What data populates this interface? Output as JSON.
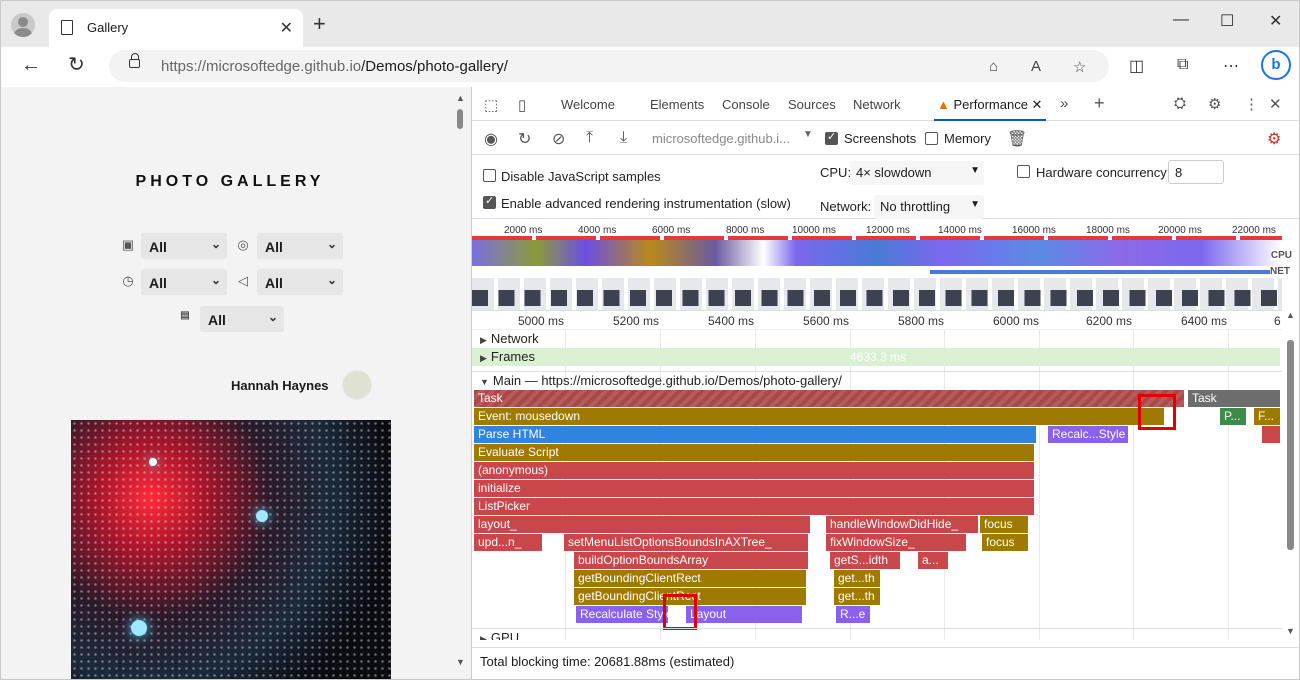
{
  "browser": {
    "tab_title": "Gallery",
    "url_host": "https://microsoftedge.github.io",
    "url_path": "/Demos/photo-gallery/"
  },
  "page": {
    "title": "PHOTO GALLERY",
    "filters": [
      {
        "icon": "camera-icon",
        "value": "All"
      },
      {
        "icon": "aperture-icon",
        "value": "All"
      },
      {
        "icon": "shutter-speed-icon",
        "value": "All"
      },
      {
        "icon": "speaker-icon",
        "value": "All"
      },
      {
        "icon": "iso-icon",
        "value": "All"
      }
    ],
    "user_name": "Hannah Haynes"
  },
  "devtools": {
    "tabs": [
      "Welcome",
      "Elements",
      "Console",
      "Sources",
      "Network",
      "Performance"
    ],
    "toolbar": {
      "recording_name": "microsoftedge.github.i...",
      "screenshots_label": "Screenshots",
      "memory_label": "Memory"
    },
    "settings": {
      "disable_js_label": "Disable JavaScript samples",
      "advanced_label": "Enable advanced rendering instrumentation (slow)",
      "cpu_label": "CPU:",
      "cpu_value": "4× slowdown",
      "network_label": "Network:",
      "network_value": "No throttling",
      "hw_label": "Hardware concurrency",
      "hw_value": "8"
    },
    "overview_ticks": [
      "2000 ms",
      "4000 ms",
      "6000 ms",
      "8000 ms",
      "10000 ms",
      "12000 ms",
      "14000 ms",
      "16000 ms",
      "18000 ms",
      "20000 ms",
      "22000 ms"
    ],
    "overview_labels": {
      "cpu": "CPU",
      "net": "NET"
    },
    "timeline_ticks": [
      "5000 ms",
      "5200 ms",
      "5400 ms",
      "5600 ms",
      "5800 ms",
      "6000 ms",
      "6200 ms",
      "6400 ms",
      "6"
    ],
    "tracks": {
      "network": "Network",
      "frames": "Frames",
      "frames_value": "4633.3 ms",
      "main": "Main — https://microsoftedge.github.io/Demos/photo-gallery/",
      "gpu": "GPU"
    },
    "flame": {
      "task": "Task",
      "task2": "Task",
      "event": "Event: mousedown",
      "p": "P...",
      "f": "F...",
      "parse": "Parse HTML",
      "recalc": "Recalc...Style",
      "evaluate": "Evaluate Script",
      "anonymous": "(anonymous)",
      "initialize": "initialize",
      "listpicker": "ListPicker",
      "layout_": "layout_",
      "hwdh": "handleWindowDidHide_",
      "focus1": "focus",
      "updn": "upd...n_",
      "setmenu": "setMenuListOptionsBoundsInAXTree_",
      "fixwin": "fixWindowSize_",
      "focus2": "focus",
      "buildopt": "buildOptionBoundsArray",
      "gets": "getS...idth",
      "a": "a...",
      "gbcr1": "getBoundingClientRect",
      "getth1": "get...th",
      "gbcr2": "getBoundingClientRect",
      "getth2": "get...th",
      "recalc_style": "Recalculate Style",
      "layout": "Layout",
      "re": "R...e"
    },
    "status": "Total blocking time: 20681.88ms (estimated)"
  }
}
